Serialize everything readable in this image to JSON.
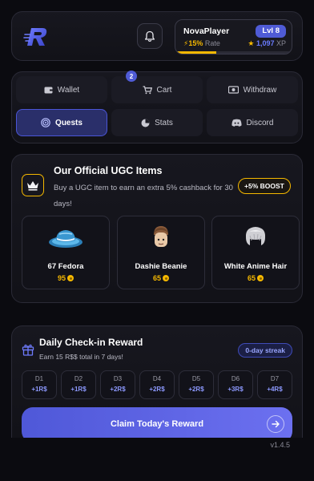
{
  "header": {
    "username": "NovaPlayer",
    "level": "Lvl 8",
    "rate_value": "15%",
    "rate_label": "Rate",
    "xp_value": "1,097",
    "xp_label": "XP",
    "xp_progress_fraction": 0.35
  },
  "nav": {
    "wallet": "Wallet",
    "cart": "Cart",
    "cart_count": "2",
    "withdraw": "Withdraw",
    "quests": "Quests",
    "stats": "Stats",
    "discord": "Discord"
  },
  "ugc": {
    "title": "Our Official UGC Items",
    "description": "Buy a UGC item to earn an extra 5% cashback for 30 days!",
    "boost": "+5% BOOST",
    "items": [
      {
        "name": "67 Fedora",
        "price": "95",
        "icon": "fedora-hat"
      },
      {
        "name": "Dashie Beanie",
        "price": "65",
        "icon": "avatar-head-beanie"
      },
      {
        "name": "White Anime Hair",
        "price": "65",
        "icon": "white-hair"
      }
    ]
  },
  "daily": {
    "title": "Daily Check-in Reward",
    "subtitle": "Earn 15 R$$ total in 7 days!",
    "streak": "0-day streak",
    "days": [
      {
        "label": "D1",
        "reward": "+1R$"
      },
      {
        "label": "D2",
        "reward": "+1R$"
      },
      {
        "label": "D3",
        "reward": "+2R$"
      },
      {
        "label": "D4",
        "reward": "+2R$"
      },
      {
        "label": "D5",
        "reward": "+2R$"
      },
      {
        "label": "D6",
        "reward": "+3R$"
      },
      {
        "label": "D7",
        "reward": "+4R$"
      }
    ],
    "claim": "Claim Today's Reward"
  },
  "version": "v1.4.5",
  "colors": {
    "accent": "#4f5bd5",
    "gold": "#f5b800",
    "background": "#0b0b10"
  }
}
